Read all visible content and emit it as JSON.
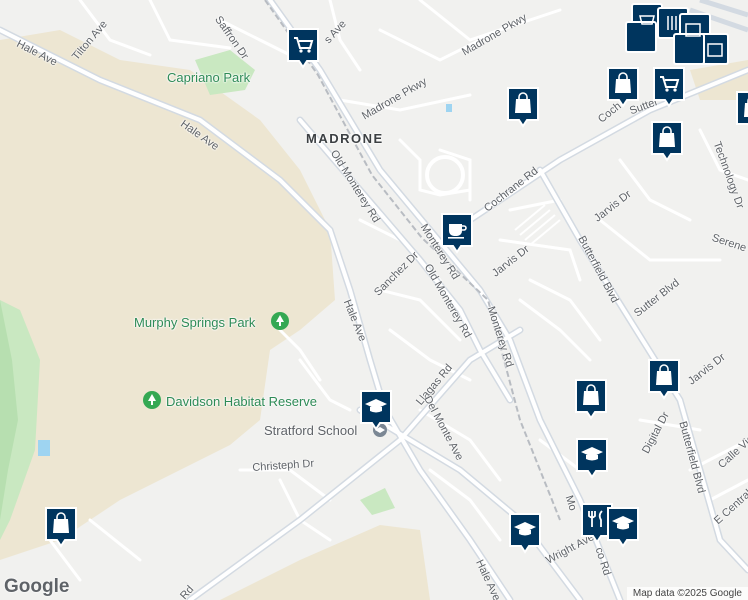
{
  "map": {
    "district": "MADRONE",
    "parks": [
      "Capriano Park",
      "Murphy Springs Park",
      "Davidson Habitat Reserve"
    ],
    "school": "Stratford School",
    "streets": {
      "tilton": "Tilton Ave",
      "saffron": "Saffron Dr",
      "s_ave": "s Ave",
      "madrone_pkwy_1": "Madrone Pkwy",
      "madrone_pkwy_2": "Madrone Pkwy",
      "hale_1": "Hale Ave",
      "hale_2": "Hale Ave",
      "hale_3": "Hale Ave",
      "hale_4": "Hale Ave",
      "old_monterey_1": "Old Monterey Rd",
      "old_monterey_2": "Old Monterey Rd",
      "cochrane": "Cochrane Rd",
      "cochrane_2": "Coch",
      "monterey_1": "Monterey Rd",
      "monterey_2": "Monterey Rd",
      "monterey_3": "Mo",
      "monterey_4": "co Rd",
      "sanchez": "Sanchez Dr",
      "jarvis_1": "Jarvis Dr",
      "jarvis_2": "Jarvis Dr",
      "jarvis_3": "Jarvis Dr",
      "butterfield_1": "Butterfield Blvd",
      "butterfield_2": "Butterfield Blvd",
      "sutter_1": "Sutter Blvd",
      "sutter_2": "Sutter",
      "technology": "Technology Dr",
      "serene": "Serene",
      "llagas": "Llagas Rd",
      "del_monte": "Del Monte Ave",
      "christeph": "Christeph Dr",
      "digital": "Digital Dr",
      "calle_vie": "Calle Vie",
      "e_central": "E Central",
      "wright": "Wright Ave",
      "rd_bottom": "Rd"
    },
    "markers": [
      {
        "type": "shopping-cart-icon"
      },
      {
        "type": "shopping-bag-icon"
      },
      {
        "type": "shopping-bag-icon"
      },
      {
        "type": "shopping-bag-icon"
      },
      {
        "type": "shopping-cart-icon"
      },
      {
        "type": "shopping-bag-icon"
      },
      {
        "type": "coffee-icon"
      },
      {
        "type": "school-icon"
      },
      {
        "type": "shopping-bag-icon"
      },
      {
        "type": "shopping-bag-icon"
      },
      {
        "type": "school-icon"
      },
      {
        "type": "shopping-bag-icon"
      },
      {
        "type": "restaurant-icon"
      },
      {
        "type": "school-icon"
      },
      {
        "type": "school-icon"
      }
    ],
    "colors": {
      "marker_fill": "#00355e",
      "park_green": "#c9e8c1",
      "hill_tan": "#ede6d2",
      "water": "#9ed4f1"
    }
  },
  "attribution": {
    "logo": "Google",
    "copyright": "Map data ©2025 Google"
  }
}
